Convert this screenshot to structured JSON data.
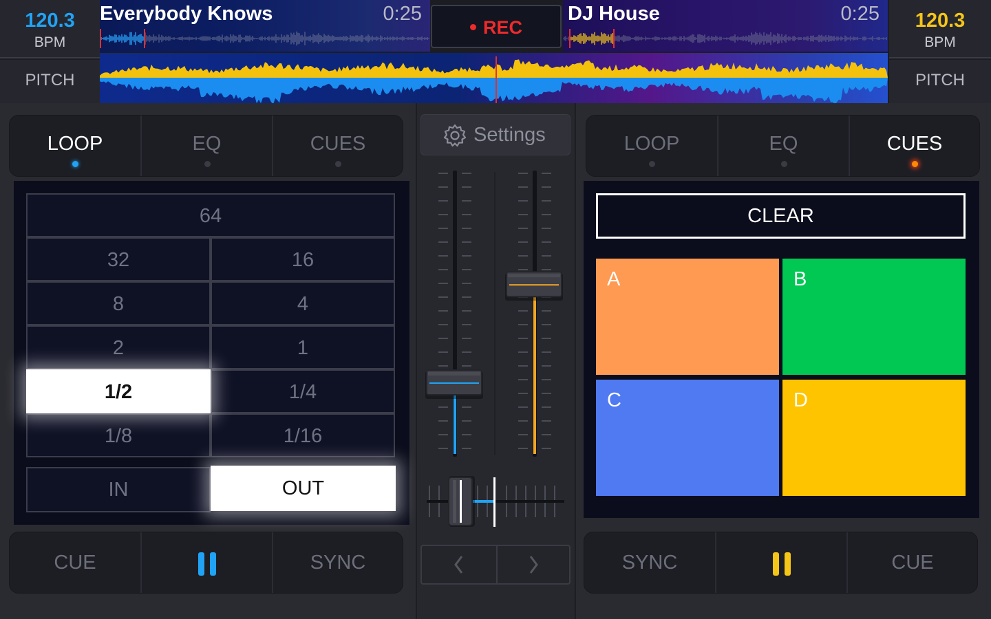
{
  "deck_a": {
    "bpm": "120.3",
    "bpm_label": "BPM",
    "pitch_label": "PITCH",
    "track_title": "Everybody Knows",
    "time": "0:25",
    "accent": "#21a3f5",
    "tabs": [
      {
        "label": "LOOP",
        "active": true
      },
      {
        "label": "EQ",
        "active": false
      },
      {
        "label": "CUES",
        "active": false
      }
    ],
    "loop": {
      "sizes": [
        "64",
        "32",
        "16",
        "8",
        "4",
        "2",
        "1",
        "1/2",
        "1/4",
        "1/8",
        "1/16"
      ],
      "selected": "1/2",
      "in_label": "IN",
      "out_label": "OUT",
      "out_active": true
    },
    "transport": {
      "cue_label": "CUE",
      "play_state": "pause-icon",
      "sync_label": "SYNC"
    }
  },
  "deck_b": {
    "bpm": "120.3",
    "bpm_label": "BPM",
    "pitch_label": "PITCH",
    "track_title": "DJ House",
    "time": "0:25",
    "accent": "#f5a623",
    "tabs": [
      {
        "label": "LOOP",
        "active": false
      },
      {
        "label": "EQ",
        "active": false
      },
      {
        "label": "CUES",
        "active": true
      }
    ],
    "cues": {
      "clear_label": "CLEAR",
      "pads": [
        {
          "label": "A",
          "color": "#ff9a52"
        },
        {
          "label": "B",
          "color": "#00c853"
        },
        {
          "label": "C",
          "color": "#4f7af2"
        },
        {
          "label": "D",
          "color": "#ffc400"
        }
      ]
    },
    "transport": {
      "sync_label": "SYNC",
      "play_state": "pause-icon",
      "cue_label": "CUE"
    }
  },
  "rec": {
    "label": "REC",
    "color": "#ee2b2b"
  },
  "mixer": {
    "settings_label": "Settings",
    "settings_icon": "gear-icon",
    "volume_a": 0.25,
    "volume_b": 0.6,
    "crossfader": 0.25,
    "nav_prev_icon": "chevron-left-icon",
    "nav_next_icon": "chevron-right-icon"
  }
}
